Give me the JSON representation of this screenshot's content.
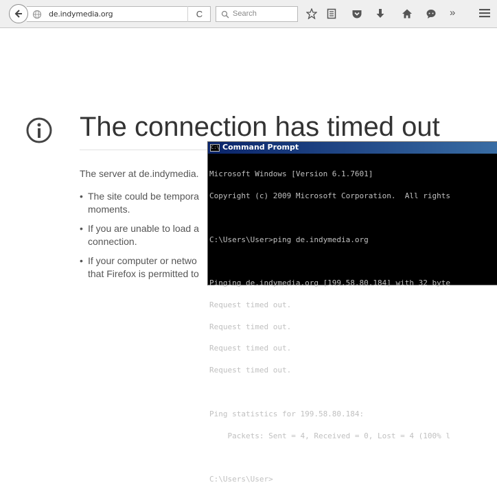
{
  "browser": {
    "url": "de.indymedia.org",
    "search_placeholder": "Search",
    "reload_glyph": "C",
    "overflow_glyph": "»"
  },
  "error_page": {
    "title": "The connection has timed out",
    "description": "The server at de.indymedia.",
    "bullets": [
      "The site could be tempora",
      "moments.",
      "If you are unable to load a",
      "connection.",
      "If your computer or netwo",
      "that Firefox is permitted to"
    ]
  },
  "cmd": {
    "title": "Command Prompt",
    "icon_text": "C:\\",
    "lines": [
      "Microsoft Windows [Version 6.1.7601]",
      "Copyright (c) 2009 Microsoft Corporation.  All rights",
      "",
      "C:\\Users\\User>ping de.indymedia.org",
      "",
      "Pinging de.indymedia.org [199.58.80.184] with 32 byte",
      "Request timed out.",
      "Request timed out.",
      "Request timed out.",
      "Request timed out.",
      "",
      "Ping statistics for 199.58.80.184:",
      "    Packets: Sent = 4, Received = 0, Lost = 4 (100% l",
      "",
      "C:\\Users\\User>"
    ]
  },
  "colors": {
    "toolbar_bg": "#efefef",
    "page_text": "#555555",
    "title_text": "#333333",
    "cmd_bg": "#000000",
    "cmd_text": "#c0c0c0",
    "cmd_titlebar": "#0a246a"
  }
}
